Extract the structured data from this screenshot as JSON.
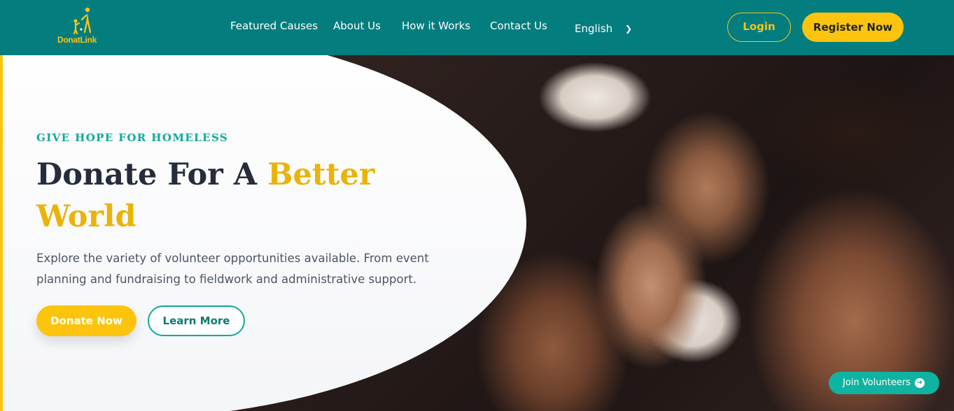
{
  "header": {
    "logo_text": "DonatLink",
    "nav": [
      "Featured Causes",
      "About Us",
      "How it Works",
      "Contact Us"
    ],
    "language": "English",
    "login_label": "Login",
    "register_label": "Register Now"
  },
  "hero": {
    "tagline": "GIVE HOPE FOR HOMELESS",
    "title_main": "Donate For A ",
    "title_accent": "Better World",
    "description": "Explore the variety of volunteer opportunities available. From event planning and fundraising to fieldwork and administrative support.",
    "donate_label": "Donate Now",
    "learn_label": "Learn More",
    "volunteer_label": "Join Volunteers"
  },
  "colors": {
    "nav_bg": "#047d7e",
    "accent_yellow": "#fcc40d",
    "accent_teal": "#10a89a",
    "title_dark": "#252c3b"
  },
  "icons": [
    "donatlink-logo-icon",
    "chevron-down-icon",
    "arrow-right-circle-icon"
  ]
}
